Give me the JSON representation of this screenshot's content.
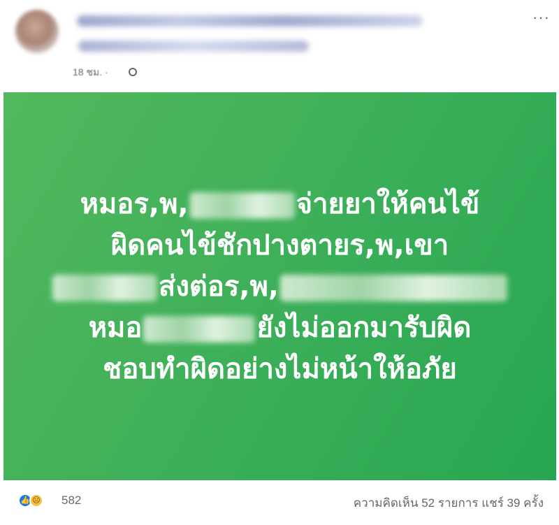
{
  "post": {
    "time_text": "18 ชม. ·",
    "privacy_icon": "globe-icon",
    "more_icon": "more-options-icon",
    "more_glyph": "···"
  },
  "media": {
    "lines": [
      {
        "parts": [
          "หมอร,พ,",
          "",
          "จ่ายยาให้คนไข้"
        ]
      },
      {
        "parts": [
          "ผิดคนไข้ชักปางตายร,พ,เขา"
        ]
      },
      {
        "parts": [
          "",
          "ส่งต่อร,พ,",
          ""
        ]
      },
      {
        "parts": [
          "หมอ",
          "",
          "ยังไม่ออกมารับผิด"
        ]
      },
      {
        "parts": [
          "ชอบทำผิดอย่างไม่หน้าให้อภัย"
        ]
      }
    ],
    "background_color": "#3fb05a",
    "text_color": "#ffffff"
  },
  "footer": {
    "reaction_icons": [
      "like-icon",
      "sad-icon"
    ],
    "reaction_count": "582",
    "comments_text": "ความคิดเห็น 52 รายการ",
    "shares_text": "แชร์ 39 ครั้ง"
  }
}
